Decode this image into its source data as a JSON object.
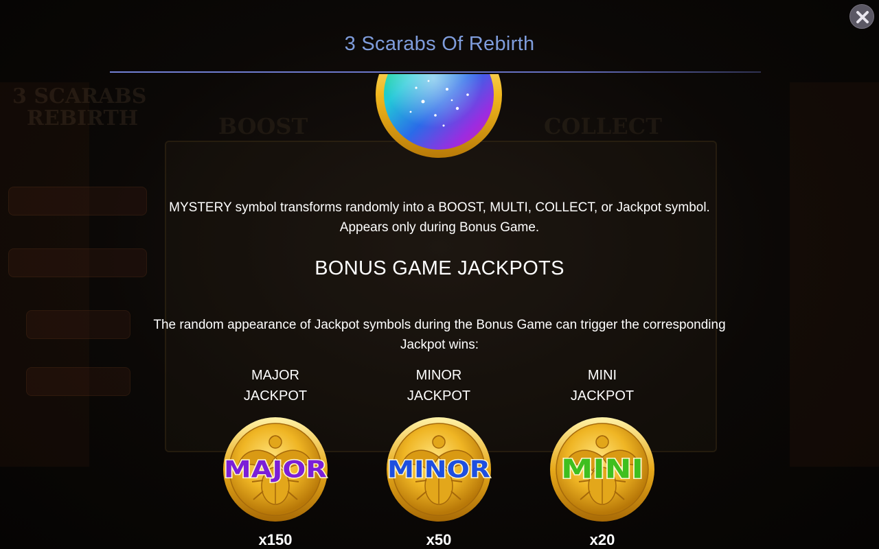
{
  "dialog": {
    "title": "3 Scarabs Of Rebirth",
    "close_icon": "close-icon"
  },
  "mystery": {
    "symbol_icon": "mystery-orb-icon",
    "line1": "MYSTERY symbol transforms randomly into a BOOST, MULTI, COLLECT, or Jackpot symbol.",
    "line2": "Appears only during Bonus Game."
  },
  "bonus": {
    "heading": "BONUS GAME JACKPOTS",
    "description_line1": "The random appearance of Jackpot symbols during the Bonus Game can trigger the corresponding",
    "description_line2": "Jackpot wins:"
  },
  "jackpots": [
    {
      "label_line1": "MAJOR",
      "label_line2": "JACKPOT",
      "coin_text": "MAJOR",
      "multiplier": "x150",
      "text_color": "#7b1fd8",
      "icon": "major-coin-icon"
    },
    {
      "label_line1": "MINOR",
      "label_line2": "JACKPOT",
      "coin_text": "MINOR",
      "multiplier": "x50",
      "text_color": "#1e4fe0",
      "icon": "minor-coin-icon"
    },
    {
      "label_line1": "MINI",
      "label_line2": "JACKPOT",
      "coin_text": "MINI",
      "multiplier": "x20",
      "text_color": "#3fbf1f",
      "icon": "mini-coin-icon"
    }
  ],
  "colors": {
    "title": "#7f9ddc",
    "rule": "#6670c2",
    "coin_gold": "#e8b020"
  }
}
